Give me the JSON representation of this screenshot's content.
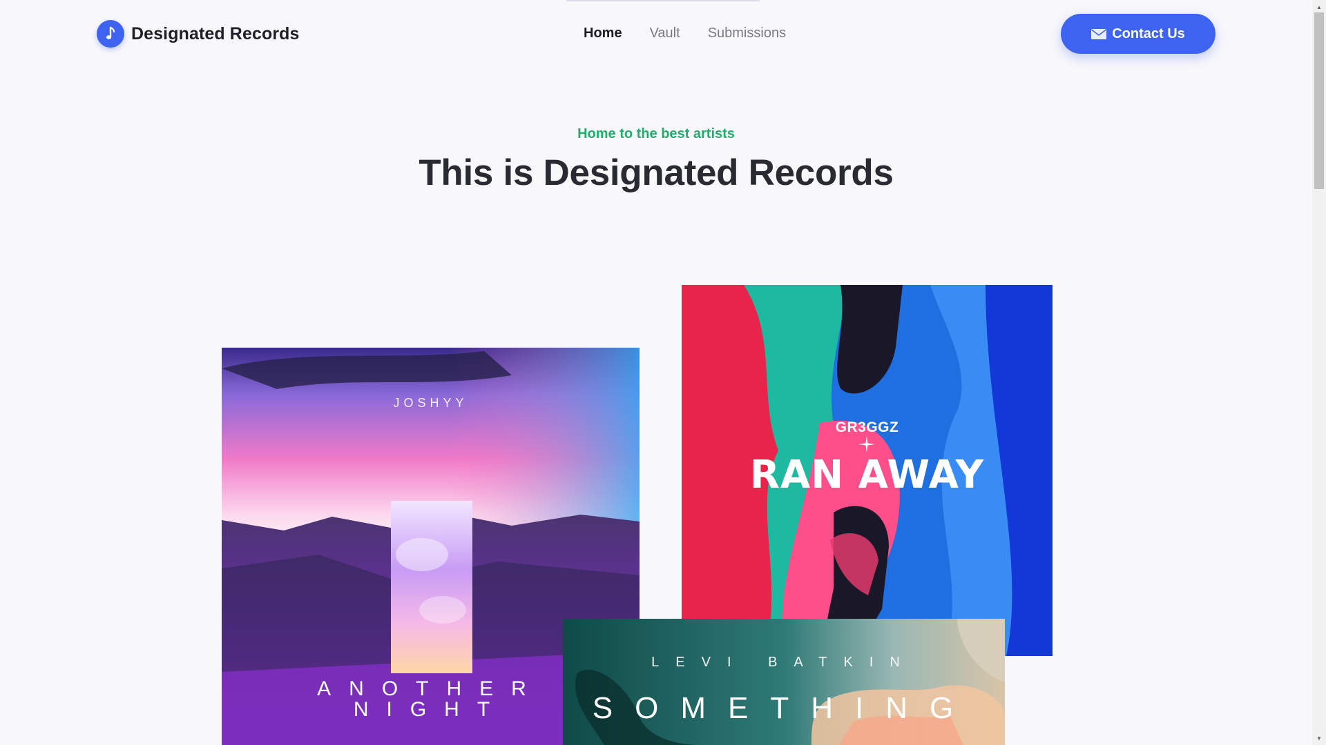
{
  "header": {
    "brand_name": "Designated Records",
    "brand_icon": "music-note-icon",
    "nav": [
      {
        "label": "Home",
        "active": true
      },
      {
        "label": "Vault",
        "active": false
      },
      {
        "label": "Submissions",
        "active": false
      }
    ],
    "contact_label": "Contact Us",
    "contact_icon": "mail-icon"
  },
  "hero": {
    "tagline": "Home to the best artists",
    "title": "This is Designated Records"
  },
  "covers": [
    {
      "artist": "JOSHYY",
      "title_line1": "ANOTHER",
      "title_line2": "NIGHT"
    },
    {
      "artist": "GR3GGZ",
      "title": "RAN AWAY"
    },
    {
      "artist": "LEVI BATKIN",
      "title": "SOMETHING"
    }
  ],
  "colors": {
    "accent": "#3e63f0",
    "tagline": "#1fae6b",
    "background": "#f8f8fb",
    "heading": "#2a2a33"
  }
}
